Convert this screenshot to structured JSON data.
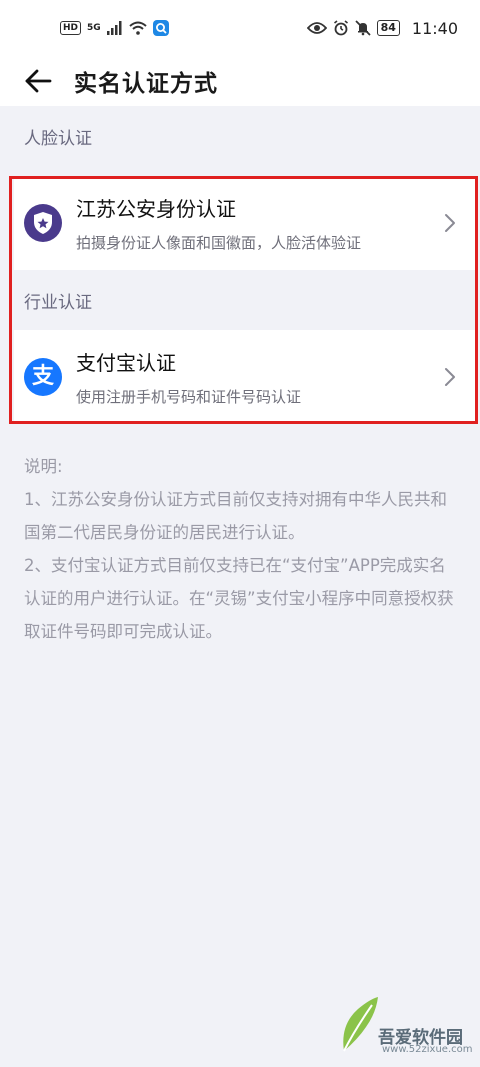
{
  "status_bar": {
    "hd_label": "HD",
    "network_label": "5G",
    "battery_level": "84",
    "time": "11:40"
  },
  "header": {
    "title": "实名认证方式"
  },
  "sections": [
    {
      "header": "人脸认证",
      "items": [
        {
          "title": "江苏公安身份认证",
          "subtitle": "拍摄身份证人像面和国徽面，人脸活体验证",
          "icon": "police-shield-icon",
          "icon_color": "#4a3a8c"
        }
      ]
    },
    {
      "header": "行业认证",
      "items": [
        {
          "title": "支付宝认证",
          "subtitle": "使用注册手机号码和证件号码认证",
          "icon": "alipay-icon",
          "icon_color": "#1677ff",
          "icon_glyph": "支"
        }
      ]
    }
  ],
  "notes": {
    "heading": "说明:",
    "line1": "1、江苏公安身份认证方式目前仅支持对拥有中华人民共和国第二代居民身份证的居民进行认证。",
    "line2": "2、支付宝认证方式目前仅支持已在“支付宝”APP完成实名认证的用户进行认证。在“灵锡”支付宝小程序中同意授权获取证件号码即可完成认证。"
  },
  "highlight_color": "#e02020",
  "watermark": {
    "brand": "吾爱软件园",
    "url": "www.52zixue.com"
  }
}
